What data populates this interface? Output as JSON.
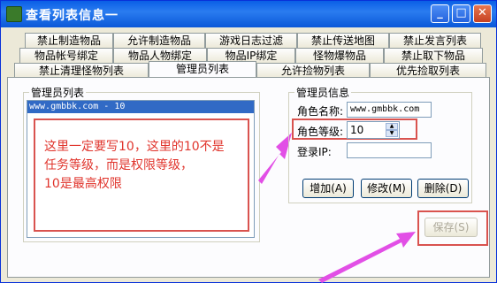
{
  "window": {
    "title": "查看列表信息一"
  },
  "tabs": {
    "row1": [
      "禁止制造物品",
      "允许制造物品",
      "游戏日志过滤",
      "禁止传送地图",
      "禁止发言列表"
    ],
    "row2": [
      "物品帐号绑定",
      "物品人物绑定",
      "物品IP绑定",
      "怪物爆物品",
      "禁止取下物品"
    ],
    "row3": [
      "禁止清理怪物列表",
      "管理员列表",
      "允许捡物列表",
      "优先捡取列表"
    ],
    "active": "管理员列表"
  },
  "admin_list": {
    "title": "管理员列表",
    "items": [
      "www.gmbbk.com - 10"
    ]
  },
  "note": {
    "lines": [
      "这里一定要写10，这里的10不是",
      "任务等级，而是权限等级，",
      "10是最高权限"
    ]
  },
  "admin_info": {
    "title": "管理员信息",
    "role_name_label": "角色名称:",
    "role_name_value": "www.gmbbk.com",
    "role_level_label": "角色等级:",
    "role_level_value": "10",
    "login_ip_label": "登录IP:",
    "login_ip_value": ""
  },
  "buttons": {
    "add": "增加(A)",
    "edit": "修改(M)",
    "delete": "删除(D)",
    "save": "保存(S)"
  }
}
